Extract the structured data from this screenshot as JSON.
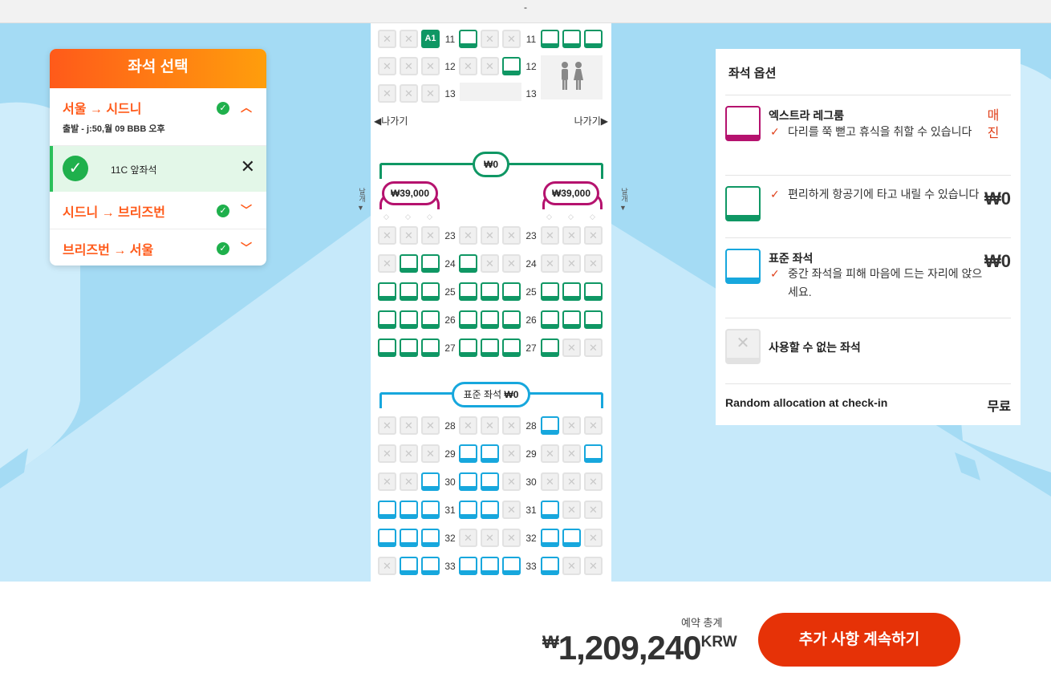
{
  "topbar": {
    "text": "-"
  },
  "left_panel": {
    "title": "좌석 선택",
    "routes": [
      {
        "title": "서울 → 시드니",
        "sub": "출발 - j:50,월 09 BBB 오후",
        "expanded": true
      },
      {
        "title": "시드니 → 브리즈번",
        "expanded": false
      },
      {
        "title": "브리즈번 → 서울",
        "expanded": false
      }
    ],
    "selected_seat": {
      "label": "11C 앞좌석"
    }
  },
  "seatmap": {
    "exit_left": "나가기",
    "exit_right": "나가기",
    "wing": "날개",
    "selected_seat_code": "A1",
    "zone_premium_price": "₩0",
    "extra_leg_price_left": "₩39,000",
    "extra_leg_price_right": "₩39,000",
    "zone_standard_label": "표준 좌석",
    "zone_standard_price": "₩0",
    "top_rows": [
      "11",
      "12",
      "13"
    ],
    "green_rows": [
      "23",
      "24",
      "25",
      "26",
      "27"
    ],
    "blue_rows": [
      "28",
      "29",
      "30",
      "31",
      "32",
      "33"
    ]
  },
  "options": {
    "title": "좌석 옵션",
    "items": [
      {
        "name": "엑스트라 레그룸",
        "desc": "다리를 쭉 뻗고 휴식을 취할 수 있습니다",
        "price": "매진",
        "color": "#b5126e"
      },
      {
        "name": "",
        "desc": "편리하게 항공기에 타고 내릴 수 있습니다",
        "price": "₩0",
        "color": "#0f9764"
      },
      {
        "name": "표준 좌석",
        "desc": "중간 좌석을 피해 마음에 드는 자리에 앉으세요.",
        "price": "₩0",
        "color": "#17a7dd"
      },
      {
        "name": "사용할 수 없는 좌석",
        "color": "#e2e2e2"
      }
    ],
    "random_label": "Random allocation at check-in",
    "random_price": "무료"
  },
  "footer": {
    "total_label": "예약 총계",
    "currency_symbol": "₩",
    "total_amount": "1,209,240",
    "currency_code": "KRW",
    "continue_label": "추가 사항 계속하기"
  }
}
